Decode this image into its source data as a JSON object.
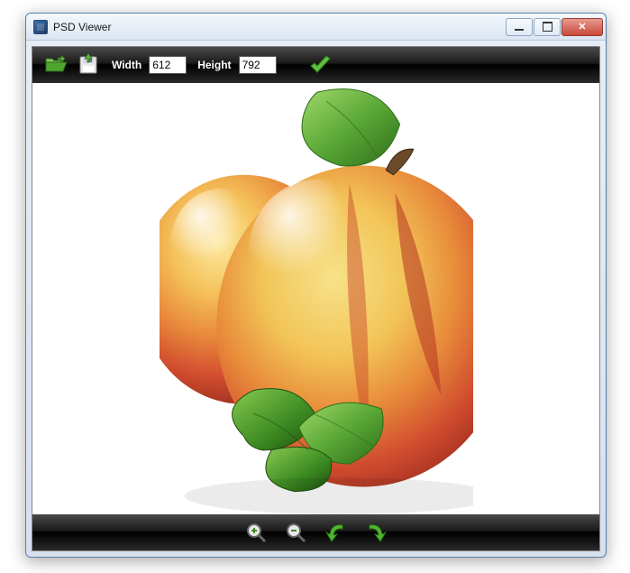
{
  "window": {
    "title": "PSD Viewer"
  },
  "toolbar": {
    "width_label": "Width",
    "width_value": "612",
    "height_label": "Height",
    "height_value": "792"
  }
}
